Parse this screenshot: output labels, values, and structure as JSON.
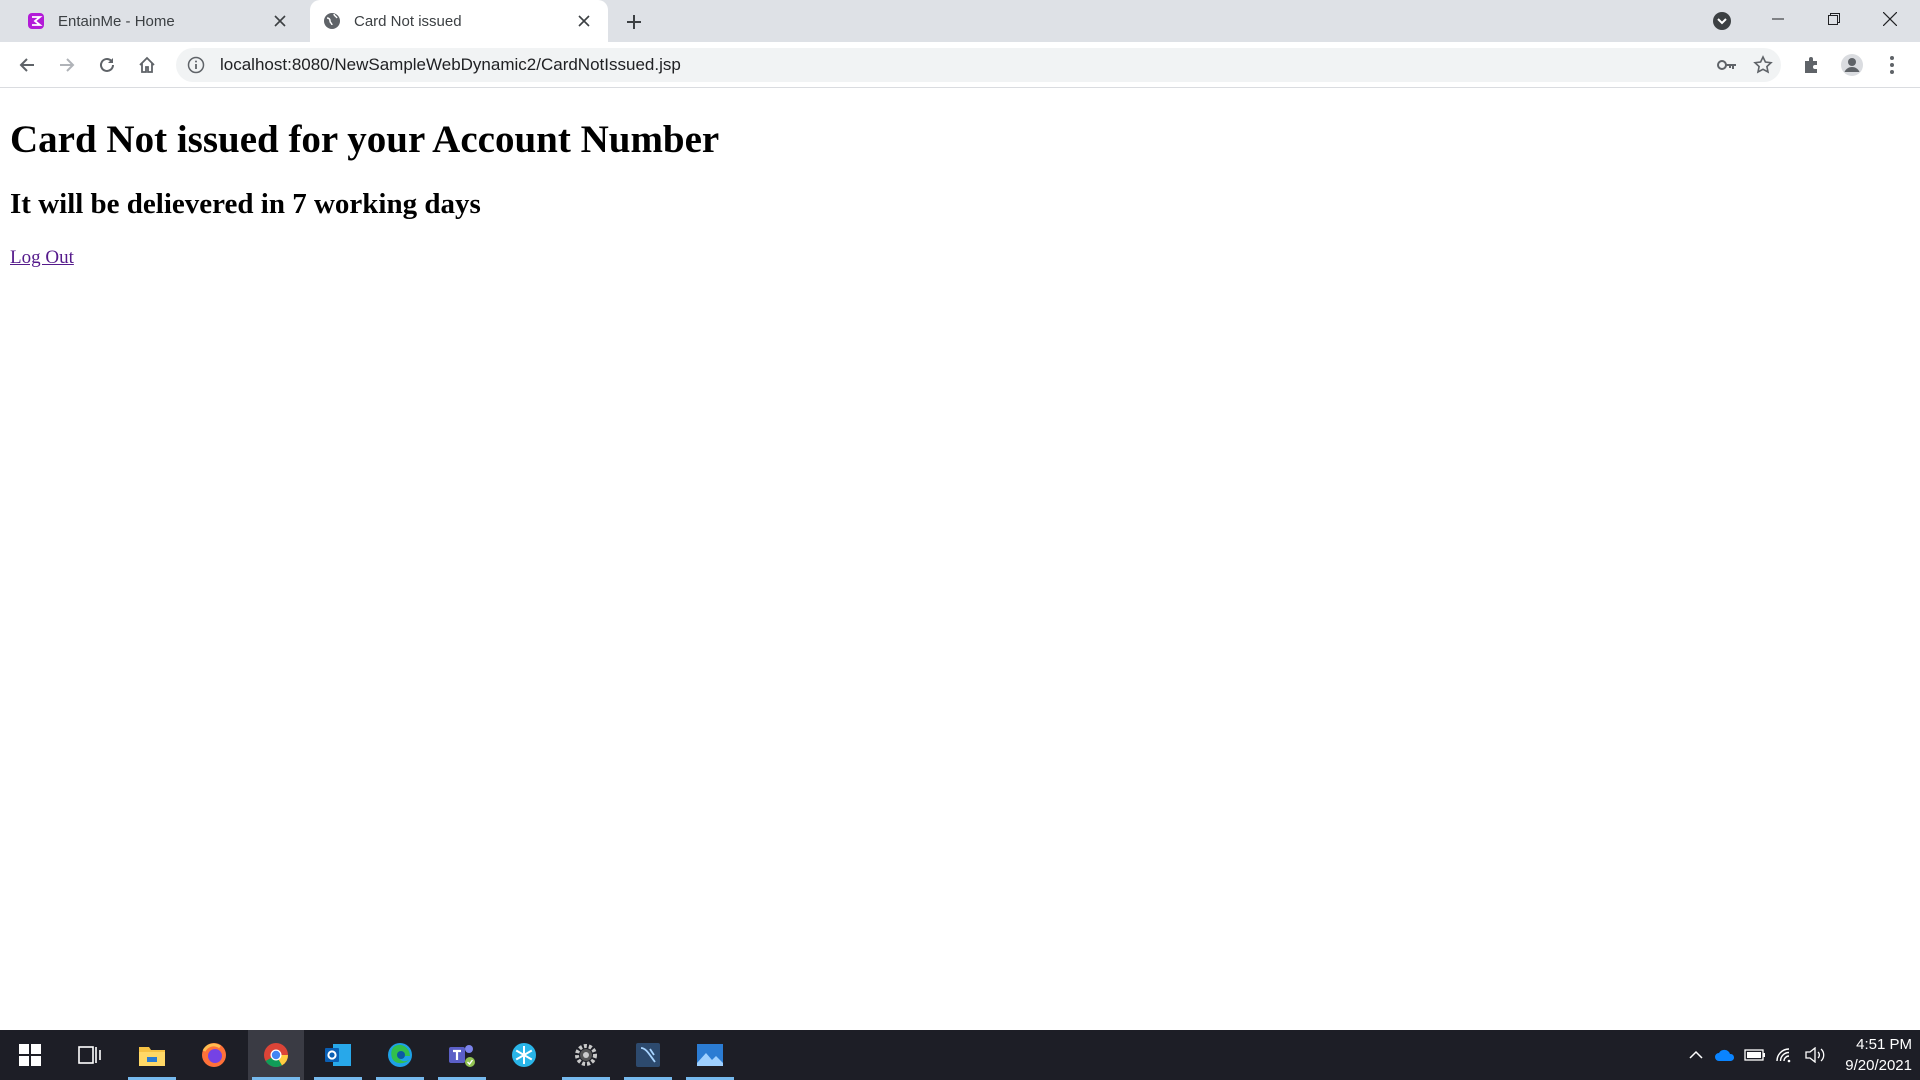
{
  "browser": {
    "tabs": [
      {
        "title": "EntainMe - Home",
        "active": false,
        "favicon": "entainme-logo-icon"
      },
      {
        "title": "Card Not issued",
        "active": true,
        "favicon": "globe-icon"
      }
    ],
    "address_url": "localhost:8080/NewSampleWebDynamic2/CardNotIssued.jsp"
  },
  "page": {
    "heading": "Card Not issued for your Account Number",
    "subheading": "It will be delievered in 7 working days",
    "logout_link": "Log Out"
  },
  "taskbar": {
    "apps": [
      "windows-start-icon",
      "task-view-icon",
      "file-explorer-icon",
      "firefox-icon",
      "chrome-icon",
      "outlook-icon",
      "edge-icon",
      "teams-icon",
      "snowflake-icon",
      "settings-gear-icon",
      "ide-icon",
      "photos-icon"
    ],
    "time": "4:51 PM",
    "date": "9/20/2021"
  },
  "colors": {
    "tabstrip": "#dee1e6",
    "link_visited": "#551a8b",
    "taskbar": "#1d1e26"
  }
}
